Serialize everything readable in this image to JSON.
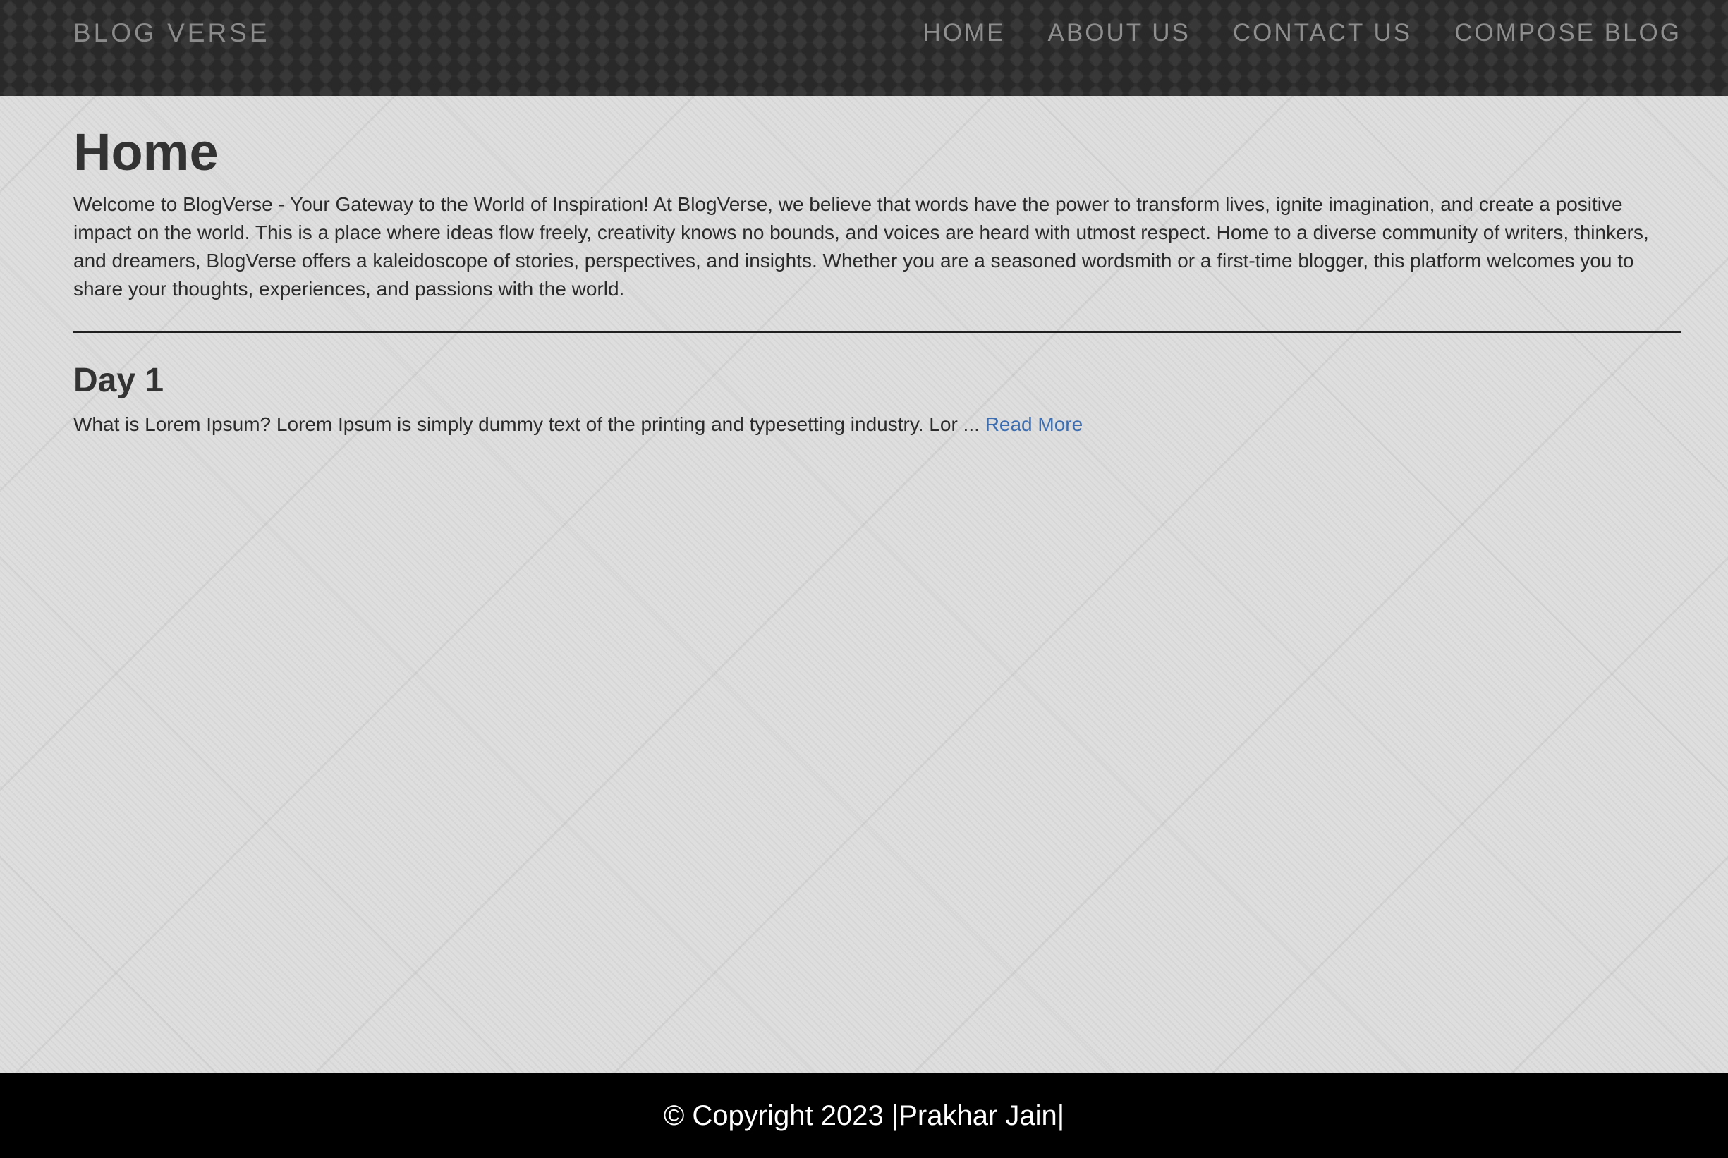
{
  "nav": {
    "brand": "BLOG VERSE",
    "links": [
      {
        "label": "HOME"
      },
      {
        "label": "ABOUT US"
      },
      {
        "label": "CONTACT US"
      },
      {
        "label": "COMPOSE BLOG"
      }
    ]
  },
  "main": {
    "title": "Home",
    "intro": "Welcome to BlogVerse - Your Gateway to the World of Inspiration! At BlogVerse, we believe that words have the power to transform lives, ignite imagination, and create a positive impact on the world. This is a place where ideas flow freely, creativity knows no bounds, and voices are heard with utmost respect. Home to a diverse community of writers, thinkers, and dreamers, BlogVerse offers a kaleidoscope of stories, perspectives, and insights. Whether you are a seasoned wordsmith or a first-time blogger, this platform welcomes you to share your thoughts, experiences, and passions with the world.",
    "posts": [
      {
        "title": "Day 1",
        "excerpt": "What is Lorem Ipsum? Lorem Ipsum is simply dummy text of the printing and typesetting industry. Lor ... ",
        "read_more": "Read More"
      }
    ]
  },
  "footer": {
    "text": "© Copyright 2023 |Prakhar Jain|"
  },
  "colors": {
    "navbar": "#2f2f2f",
    "nav_text": "#8e8e8e",
    "link": "#3c6db0",
    "footer": "#000000"
  }
}
